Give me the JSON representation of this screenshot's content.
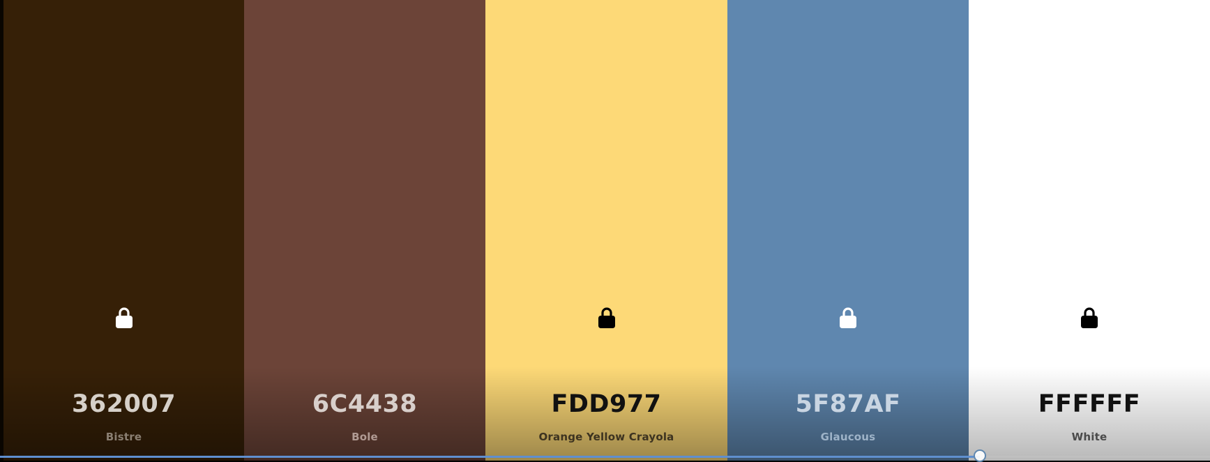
{
  "palette": {
    "swatches": [
      {
        "hex": "362007",
        "name": "Bistre",
        "color": "#362007",
        "hex_text_color": "#d6d0c9",
        "name_text_color": "#8a7f72",
        "lock_color": "#ffffff",
        "show_lock": true
      },
      {
        "hex": "6C4438",
        "name": "Bole",
        "color": "#6c4438",
        "hex_text_color": "#d8cfcb",
        "name_text_color": "#b09a93",
        "lock_color": "#ffffff",
        "show_lock": false
      },
      {
        "hex": "FDD977",
        "name": "Orange Yellow Crayola",
        "color": "#fdd977",
        "hex_text_color": "#111111",
        "name_text_color": "#3d3320",
        "lock_color": "#000000",
        "show_lock": true
      },
      {
        "hex": "5F87AF",
        "name": "Glaucous",
        "color": "#5f87af",
        "hex_text_color": "#c9d5e2",
        "name_text_color": "#9eb3c8",
        "lock_color": "#ffffff",
        "show_lock": true
      },
      {
        "hex": "FFFFFF",
        "name": "White",
        "color": "#ffffff",
        "hex_text_color": "#111111",
        "name_text_color": "#4a4a4a",
        "lock_color": "#000000",
        "show_lock": true
      }
    ]
  },
  "playback": {
    "progress_fraction": 0.81,
    "fill_color": "#5f8fcf"
  },
  "icons": {
    "lock": "lock-icon"
  }
}
